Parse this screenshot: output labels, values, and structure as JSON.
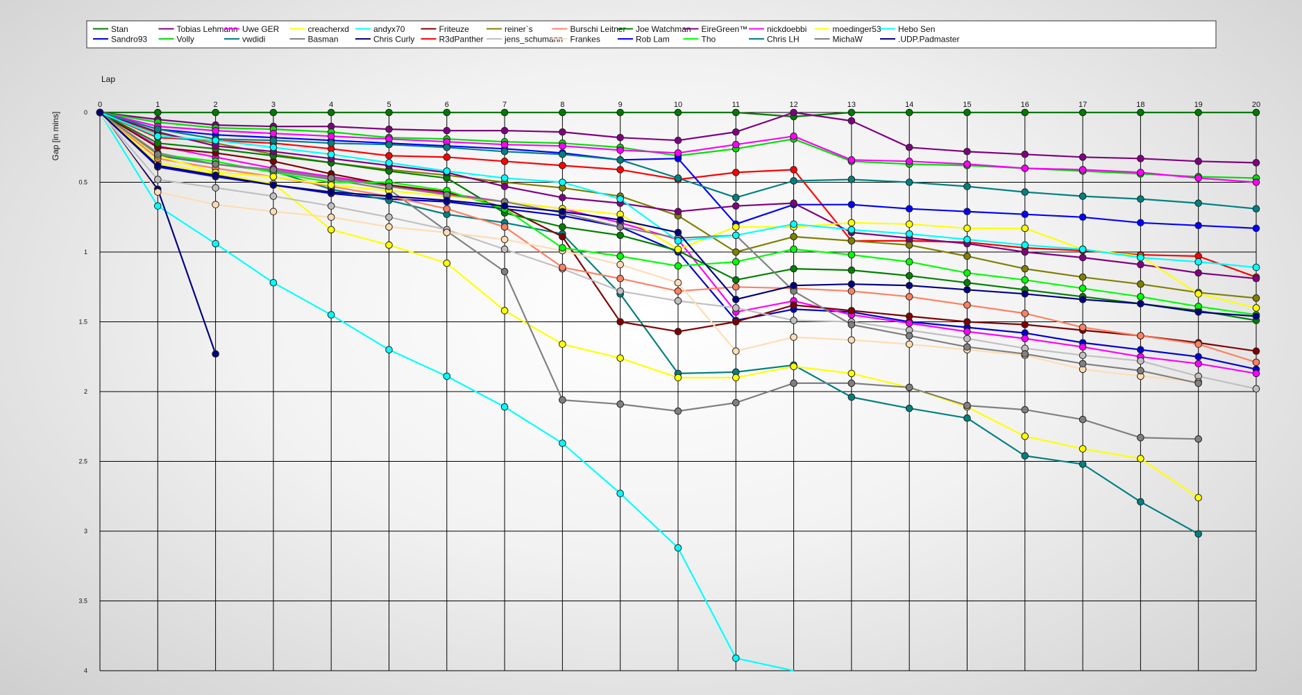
{
  "chart_data": {
    "type": "line",
    "xlabel": "Lap",
    "ylabel": "Gap [in mins]",
    "xlim": [
      0,
      20
    ],
    "ylim": [
      0,
      4
    ],
    "x_ticks": [
      "0",
      "1",
      "2",
      "3",
      "4",
      "5",
      "6",
      "7",
      "8",
      "9",
      "10",
      "11",
      "12",
      "13",
      "14",
      "15",
      "16",
      "17",
      "18",
      "19",
      "20"
    ],
    "y_ticks": [
      "0",
      "0.5",
      "1",
      "1.5",
      "2",
      "2.5",
      "3",
      "3.5",
      "4"
    ],
    "y_inverted": true,
    "grid": true,
    "legend_position": "top",
    "x": [
      0,
      1,
      2,
      3,
      4,
      5,
      6,
      7,
      8,
      9,
      10,
      11,
      12,
      13,
      14,
      15,
      16,
      17,
      18,
      19,
      20
    ],
    "series": [
      {
        "name": "Stan",
        "color": "#007a00",
        "values": [
          0,
          0,
          0,
          0,
          0,
          0,
          0,
          0,
          0,
          0,
          0,
          0,
          0.03,
          0,
          0,
          0,
          0,
          0,
          0,
          0,
          0
        ]
      },
      {
        "name": "Sandro93",
        "color": "#0000d0",
        "values": [
          0,
          0.39,
          0.46,
          0.52,
          0.58,
          0.62,
          0.64,
          0.69,
          0.74,
          0.82,
          1.0,
          1.49,
          1.41,
          1.43,
          1.5,
          1.54,
          1.58,
          1.65,
          1.7,
          1.75,
          1.84
        ]
      },
      {
        "name": "Tobias Lehmann",
        "color": "#800080",
        "values": [
          0,
          0.05,
          0.09,
          0.1,
          0.1,
          0.12,
          0.13,
          0.13,
          0.14,
          0.18,
          0.2,
          0.14,
          0,
          0.06,
          0.25,
          0.28,
          0.3,
          0.32,
          0.33,
          0.35,
          0.36
        ]
      },
      {
        "name": "Volly",
        "color": "#00e000",
        "values": [
          0,
          0.07,
          0.11,
          0.12,
          0.14,
          0.18,
          0.19,
          0.21,
          0.22,
          0.25,
          0.31,
          0.26,
          0.19,
          0.35,
          0.37,
          0.38,
          0.4,
          0.42,
          0.44,
          0.46,
          0.47
        ]
      },
      {
        "name": "Uwe GER",
        "color": "#ff00ff",
        "values": [
          0,
          0.24,
          0.32,
          0.4,
          0.46,
          0.52,
          0.58,
          0.64,
          0.69,
          0.79,
          0.91,
          1.43,
          1.35,
          1.45,
          1.51,
          1.57,
          1.62,
          1.68,
          1.75,
          1.8,
          1.87
        ]
      },
      {
        "name": "vwdidi",
        "color": "#008080",
        "values": [
          0,
          0.31,
          0.37,
          0.42,
          0.55,
          0.63,
          0.73,
          0.79,
          0.87,
          1.3,
          1.87,
          1.86,
          1.81,
          2.04,
          2.12,
          2.19,
          2.46,
          2.52,
          2.79,
          3.02,
          null
        ]
      },
      {
        "name": "creacherxd",
        "color": "#ffff00",
        "values": [
          0,
          0.36,
          0.44,
          0.51,
          0.84,
          0.95,
          1.08,
          1.42,
          1.66,
          1.76,
          1.9,
          1.9,
          1.82,
          1.87,
          1.97,
          2.11,
          2.32,
          2.41,
          2.48,
          2.76,
          null
        ]
      },
      {
        "name": "Basman",
        "color": "#808080",
        "values": [
          0,
          0.29,
          0.37,
          0.42,
          0.48,
          0.55,
          0.85,
          1.14,
          2.06,
          2.09,
          2.14,
          2.08,
          1.94,
          1.94,
          1.97,
          2.1,
          2.13,
          2.2,
          2.33,
          2.34,
          null
        ]
      },
      {
        "name": "andyx70",
        "color": "#00ffff",
        "values": [
          0,
          0.67,
          0.94,
          1.22,
          1.45,
          1.7,
          1.89,
          2.11,
          2.37,
          2.73,
          3.12,
          3.91,
          4.0,
          null,
          null,
          null,
          null,
          null,
          null,
          null,
          null
        ]
      },
      {
        "name": "Chris Curly",
        "color": "#000080",
        "values": [
          0,
          0.55,
          1.73,
          null,
          null,
          null,
          null,
          null,
          null,
          null,
          null,
          null,
          null,
          null,
          null,
          null,
          null,
          null,
          null,
          null,
          null
        ]
      },
      {
        "name": "Friteuze",
        "color": "#800000",
        "values": [
          0,
          0.25,
          0.29,
          0.35,
          0.44,
          0.52,
          0.57,
          0.68,
          0.89,
          1.5,
          1.57,
          1.5,
          1.38,
          1.42,
          1.46,
          1.5,
          1.52,
          1.56,
          1.6,
          1.65,
          1.71
        ]
      },
      {
        "name": "R3dPanther",
        "color": "#ff0000",
        "values": [
          0,
          0.18,
          0.2,
          0.22,
          0.26,
          0.31,
          0.32,
          0.35,
          0.38,
          0.41,
          0.48,
          0.43,
          0.41,
          0.92,
          0.92,
          0.93,
          0.97,
          0.99,
          1.02,
          1.03,
          1.18
        ]
      },
      {
        "name": "reiner`s",
        "color": "#808000",
        "values": [
          0,
          0.15,
          0.22,
          0.3,
          0.36,
          0.41,
          0.45,
          0.5,
          0.54,
          0.6,
          0.74,
          1.0,
          0.89,
          0.92,
          0.95,
          1.03,
          1.12,
          1.18,
          1.23,
          1.29,
          1.33
        ]
      },
      {
        "name": "jens_schumann",
        "color": "#c0c0c0",
        "values": [
          0,
          0.48,
          0.54,
          0.6,
          0.67,
          0.75,
          0.84,
          0.98,
          1.12,
          1.28,
          1.35,
          1.4,
          1.49,
          1.5,
          1.56,
          1.62,
          1.69,
          1.74,
          1.78,
          1.89,
          1.98
        ]
      },
      {
        "name": "Burschi Leitner",
        "color": "#ff8060",
        "values": [
          0,
          0.33,
          0.4,
          0.46,
          0.53,
          0.6,
          0.69,
          0.82,
          1.11,
          1.19,
          1.28,
          1.25,
          1.26,
          1.28,
          1.32,
          1.38,
          1.44,
          1.54,
          1.6,
          1.66,
          1.79
        ]
      },
      {
        "name": "Frankes",
        "color": "#ffdcb4",
        "values": [
          0,
          0.57,
          0.66,
          0.71,
          0.75,
          0.82,
          0.86,
          0.91,
          0.99,
          1.09,
          1.22,
          1.71,
          1.61,
          1.63,
          1.66,
          1.7,
          1.74,
          1.84,
          1.89,
          1.93,
          null
        ]
      },
      {
        "name": "Joe Watchman",
        "color": "#008000",
        "values": [
          0,
          0.22,
          0.26,
          0.31,
          0.36,
          0.42,
          0.47,
          0.72,
          0.82,
          0.88,
          0.99,
          1.2,
          1.12,
          1.13,
          1.17,
          1.22,
          1.27,
          1.32,
          1.37,
          1.42,
          1.49
        ]
      },
      {
        "name": "Rob Lam",
        "color": "#0000ff",
        "values": [
          0,
          0.12,
          0.16,
          0.18,
          0.2,
          0.22,
          0.24,
          0.26,
          0.29,
          0.34,
          0.33,
          0.8,
          0.66,
          0.66,
          0.69,
          0.71,
          0.73,
          0.75,
          0.79,
          0.81,
          0.83
        ]
      },
      {
        "name": "EireGreen™",
        "color": "#800080",
        "values": [
          0,
          0.14,
          0.24,
          0.28,
          0.33,
          0.38,
          0.43,
          0.53,
          0.61,
          0.65,
          0.71,
          0.67,
          0.65,
          0.86,
          0.9,
          0.94,
          1.0,
          1.04,
          1.09,
          1.15,
          1.19
        ]
      },
      {
        "name": "Tho",
        "color": "#00ff00",
        "values": [
          0,
          0.3,
          0.35,
          0.43,
          0.5,
          0.5,
          0.56,
          0.69,
          0.97,
          1.03,
          1.1,
          1.07,
          0.98,
          1.02,
          1.07,
          1.15,
          1.2,
          1.26,
          1.32,
          1.39,
          1.45
        ]
      },
      {
        "name": "nickdoebbi",
        "color": "#ff00ff",
        "values": [
          0,
          0.1,
          0.13,
          0.15,
          0.17,
          0.19,
          0.21,
          0.23,
          0.24,
          0.27,
          0.29,
          0.23,
          0.17,
          0.34,
          0.35,
          0.37,
          0.4,
          0.41,
          0.43,
          0.47,
          0.5
        ]
      },
      {
        "name": "Chris LH",
        "color": "#008080",
        "values": [
          0,
          0.12,
          0.19,
          0.2,
          0.22,
          0.23,
          0.25,
          0.28,
          0.3,
          0.34,
          0.47,
          0.61,
          0.49,
          0.48,
          0.5,
          0.53,
          0.57,
          0.6,
          0.62,
          0.65,
          0.69
        ]
      },
      {
        "name": "moedinger53",
        "color": "#ffff00",
        "values": [
          0,
          0.31,
          0.43,
          0.46,
          0.52,
          0.56,
          0.6,
          0.64,
          0.69,
          0.73,
          0.98,
          0.82,
          0.82,
          0.79,
          0.8,
          0.83,
          0.83,
          0.98,
          1.03,
          1.3,
          1.4
        ]
      },
      {
        "name": "MichaW",
        "color": "#808080",
        "values": [
          0,
          0.3,
          0.37,
          0.41,
          0.47,
          0.53,
          0.59,
          0.64,
          0.72,
          0.82,
          0.9,
          0.88,
          1.28,
          1.52,
          1.6,
          1.68,
          1.73,
          1.8,
          1.85,
          1.94,
          null
        ]
      },
      {
        "name": "Hebo Sen",
        "color": "#00ffff",
        "values": [
          0,
          0.17,
          0.2,
          0.25,
          0.3,
          0.36,
          0.42,
          0.47,
          0.5,
          0.62,
          0.92,
          0.88,
          0.8,
          0.84,
          0.87,
          0.91,
          0.95,
          0.98,
          1.04,
          1.07,
          1.11
        ]
      },
      {
        "name": ".UDP.Padmaster",
        "color": "#000080",
        "values": [
          0,
          0.38,
          0.45,
          0.52,
          0.57,
          0.6,
          0.63,
          0.67,
          0.71,
          0.77,
          0.86,
          1.34,
          1.24,
          1.23,
          1.24,
          1.27,
          1.3,
          1.34,
          1.37,
          1.43,
          1.46
        ]
      }
    ]
  }
}
